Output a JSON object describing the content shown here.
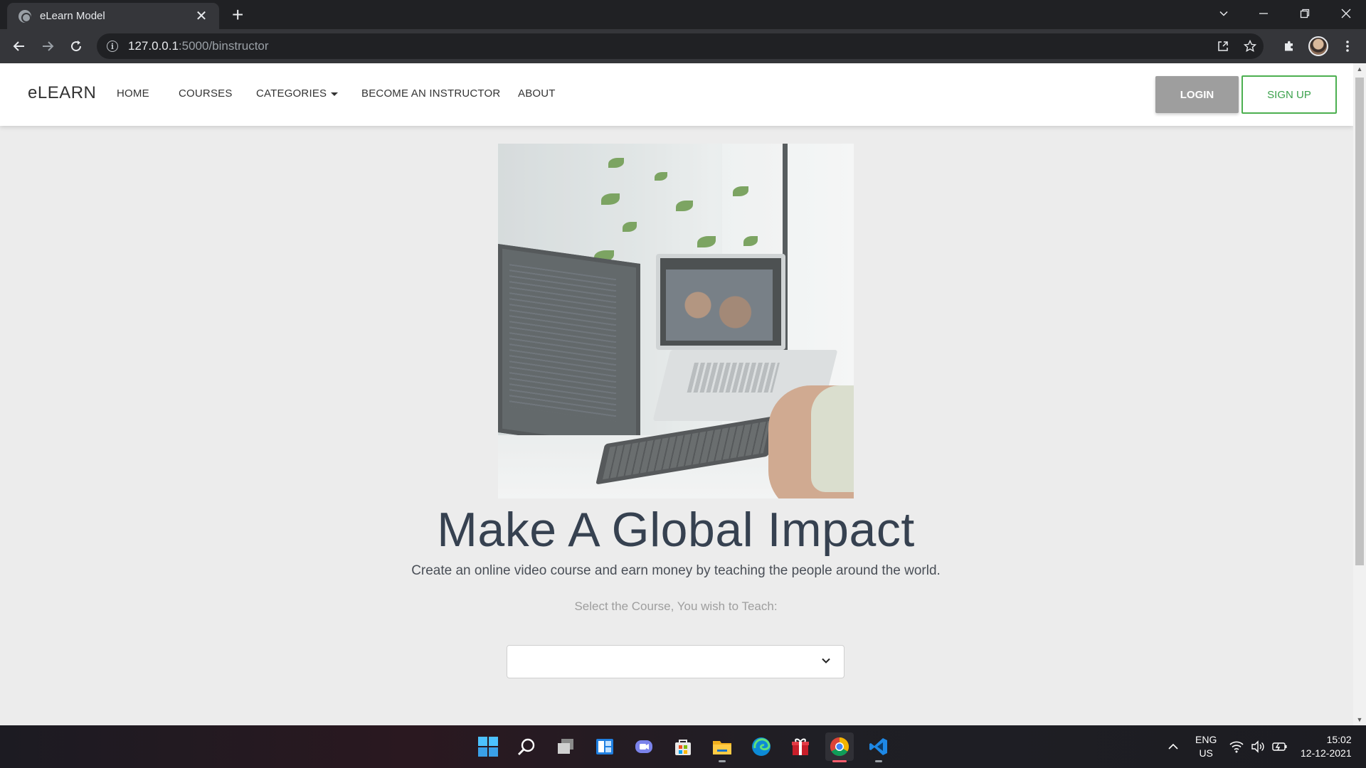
{
  "browser": {
    "tab_title": "eLearn Model",
    "tab_close": "✕",
    "new_tab": "+",
    "url_host": "127.0.0.1",
    "url_path": ":5000/binstructor",
    "icons": [
      "globe-icon",
      "back-arrow-icon",
      "forward-arrow-icon",
      "reload-icon",
      "info-icon",
      "share-icon",
      "star-icon",
      "puzzle-icon",
      "avatar",
      "kebab-menu-icon",
      "chevron-down-icon",
      "minimize-icon",
      "restore-icon",
      "close-icon"
    ]
  },
  "site": {
    "brand": "eLEARN",
    "nav": {
      "home": "HOME",
      "courses": "COURSES",
      "categories": "CATEGORIES",
      "become_instructor": "BECOME AN INSTRUCTOR",
      "about": "ABOUT"
    },
    "login": "LOGIN",
    "signup": "SIGN UP",
    "colors": {
      "login_bg": "#9e9e9e",
      "signup_accent": "#4caf50",
      "headline": "#364150",
      "page_bg": "#ececec"
    }
  },
  "main": {
    "headline": "Make A Global Impact",
    "subline": "Create an online video course and earn money by teaching the people around the world.",
    "prompt": "Select the Course, You wish to Teach:",
    "select_value": ""
  },
  "taskbar": {
    "apps": [
      "windows-start-icon",
      "search-icon",
      "task-view-icon",
      "widgets-icon",
      "teams-chat-icon",
      "store-icon",
      "file-explorer-icon",
      "edge-icon",
      "gift-app-icon",
      "chrome-icon",
      "vscode-icon"
    ],
    "lang_primary": "ENG",
    "lang_secondary": "US",
    "time": "15:02",
    "date": "12-12-2021"
  }
}
